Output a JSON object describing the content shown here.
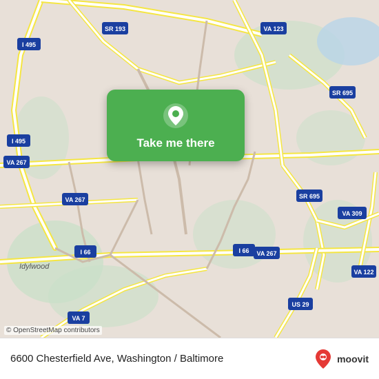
{
  "map": {
    "popup_label": "Take me there",
    "copyright": "© OpenStreetMap contributors"
  },
  "info_bar": {
    "address": "6600 Chesterfield Ave, Washington / Baltimore",
    "brand": "moovit"
  },
  "roads": {
    "highway_color": "#f5e642",
    "road_color": "#ffffff",
    "bg_color": "#e8e0d8",
    "green_area": "#c8dfc8",
    "gray_area": "#d0c8c0"
  },
  "labels": {
    "i495_1": "I 495",
    "i495_2": "I 495",
    "va267_1": "VA 267",
    "va267_2": "VA 267",
    "va267_3": "VA 267",
    "sr193": "SR 193",
    "va123": "VA 123",
    "sr695_1": "SR 695",
    "sr695_2": "SR 695",
    "sr309": "VA 309",
    "i66_1": "I 66",
    "i66_2": "I 66",
    "va7": "VA 7",
    "us29": "US 29",
    "va122": "VA 122",
    "idylwood": "Idylwood"
  },
  "icons": {
    "pin": "location-pin-icon",
    "moovit_marker": "moovit-brand-icon"
  }
}
